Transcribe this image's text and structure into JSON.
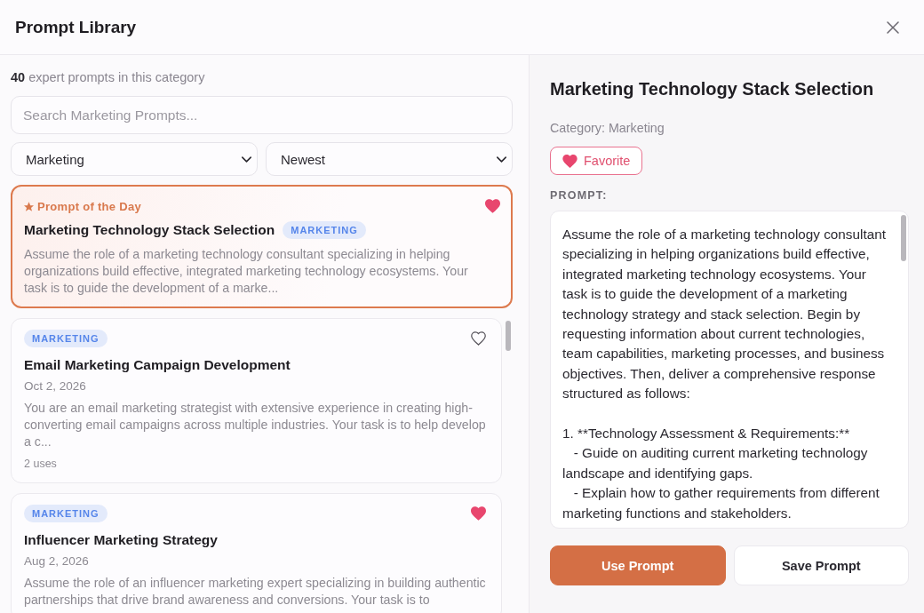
{
  "window": {
    "title": "Prompt Library"
  },
  "list": {
    "count_text": "**40** expert prompts in this category",
    "search": {
      "placeholder": "Search Marketing Prompts..."
    },
    "filters": [
      {
        "value": "Marketing"
      },
      {
        "value": "Newest"
      }
    ]
  },
  "featured": {
    "label": "Prompt of the Day",
    "title": "Marketing Technology Stack Selection",
    "badge": "MARKETING",
    "favorite": true,
    "selected": true,
    "description": "Assume the role of a marketing technology consultant specializing in helping organizations build effective, integrated marketing technology ecosystems. Your task is to guide the development of a marke..."
  },
  "prompts": [
    {
      "badge": "MARKETING",
      "favorite": false,
      "selected": false,
      "title": "Email Marketing Campaign Development",
      "date": "Oct 2, 2026",
      "description": "You are an email marketing strategist with extensive experience in creating high-converting email campaigns across multiple industries. Your task is to help develop a c...",
      "uses": "2 uses"
    },
    {
      "badge": "MARKETING",
      "favorite": true,
      "selected": false,
      "title": "Influencer Marketing Strategy",
      "date": "Aug 2, 2026",
      "description": "Assume the role of an influencer marketing expert specializing in building authentic partnerships that drive brand awareness and conversions. Your task is to"
    }
  ],
  "detail": {
    "title": "Marketing Technology Stack Selection",
    "category": "Category: Marketing",
    "favorite_button": {
      "label": "Favorite",
      "favorite": true
    },
    "prompt_label": "PROMPT:",
    "prompt_text": "Assume the role of a marketing technology consultant specializing in helping organizations build effective, integrated marketing technology ecosystems. Your task is to guide the development of a marketing technology strategy and stack selection. Begin by requesting information about current technologies, team capabilities, marketing processes, and business objectives. Then, deliver a comprehensive response structured as follows:\n\n1. **Technology Assessment & Requirements:**\n   - Guide on auditing current marketing technology landscape and identifying gaps.\n   - Explain how to gather requirements from different marketing functions and stakeholders.",
    "buttons": [
      {
        "label": "Use Prompt",
        "kind": "primary"
      },
      {
        "label": "Save Prompt",
        "kind": "secondary"
      }
    ]
  }
}
